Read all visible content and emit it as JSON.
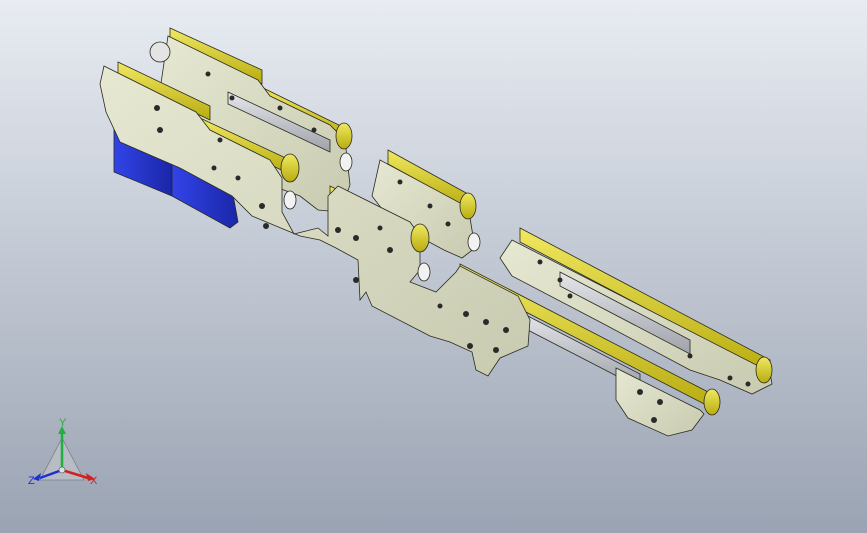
{
  "viewport": {
    "background_top": "#e8ecf2",
    "background_bottom": "#9aa3b3"
  },
  "model": {
    "plate_color": "#d9dcc3",
    "belt_color": "#d9cf2a",
    "motor_color": "#1f2fd6",
    "rail_color": "#c8cbd0"
  },
  "triad": {
    "y_label": "Y",
    "z_label": "Z",
    "x_label": "X",
    "x_color": "#d42020",
    "y_color": "#20b040",
    "z_color": "#2030d0"
  }
}
